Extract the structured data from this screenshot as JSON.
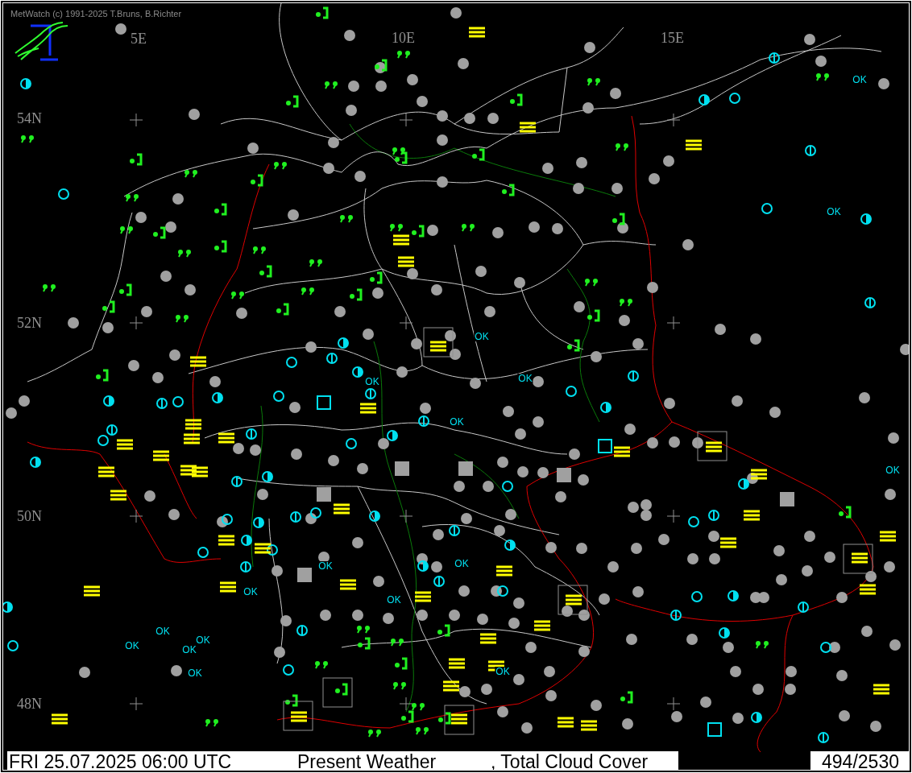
{
  "header": {
    "credit": "MetWatch  (c) 1991-2025 T.Bruns, B.Richter"
  },
  "grid_labels": [
    {
      "text": "5E"
    },
    {
      "text": "10E"
    },
    {
      "text": "15E"
    },
    {
      "text": "54N"
    },
    {
      "text": "52N"
    },
    {
      "text": "50N"
    },
    {
      "text": "48N"
    }
  ],
  "station_labels": [
    {
      "text": "OK"
    },
    {
      "text": "OK"
    },
    {
      "text": "OK"
    },
    {
      "text": "OK"
    },
    {
      "text": "OK"
    },
    {
      "text": "OK"
    },
    {
      "text": "OK"
    },
    {
      "text": "OK"
    },
    {
      "text": "OK"
    },
    {
      "text": "OK"
    },
    {
      "text": "OK"
    },
    {
      "text": "OK"
    },
    {
      "text": "OK"
    },
    {
      "text": "OK"
    },
    {
      "text": "OK"
    },
    {
      "text": "OK"
    },
    {
      "text": "OK"
    }
  ],
  "status_bar": {
    "datetime": "FRI 25.07.2025 06:00 UTC",
    "parameter": "Present Weather",
    "overlay": ", Total Cloud Cover",
    "count": "494/2530"
  }
}
